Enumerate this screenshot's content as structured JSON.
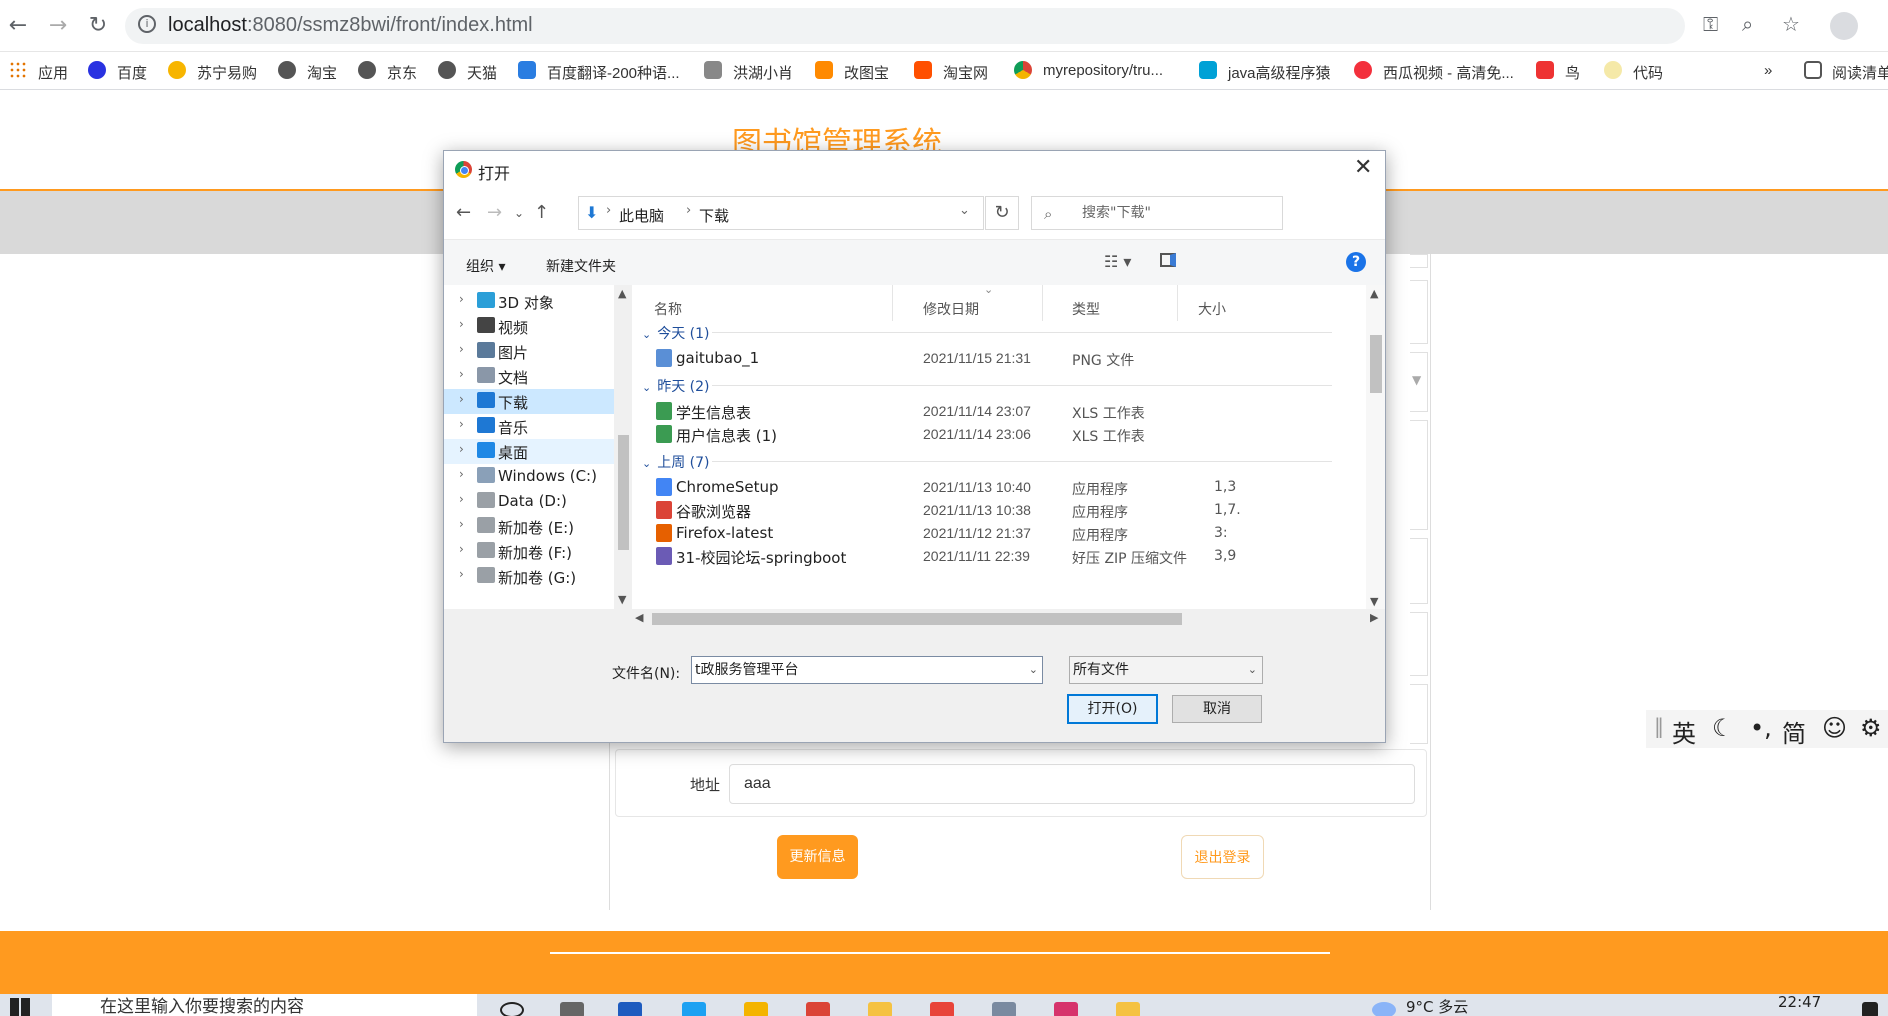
{
  "browser": {
    "url_host": "localhost",
    "url_path": ":8080/ssmz8bwi/front/index.html",
    "bookmarks": [
      "应用",
      "百度",
      "苏宁易购",
      "淘宝",
      "京东",
      "天猫",
      "百度翻译-200种语...",
      "洪湖小肖",
      "改图宝",
      "淘宝网",
      "myrepository/tru...",
      "java高级程序猿",
      "西瓜视频 - 高清免...",
      "鸟",
      "代码"
    ],
    "overflow": "»",
    "reading_list": "阅读清单"
  },
  "page": {
    "site_title": "图书馆管理系统",
    "address_label": "地址",
    "address_value": "aaa",
    "update_button": "更新信息",
    "logout_button": "退出登录"
  },
  "dialog": {
    "title": "打开",
    "breadcrumb": [
      "此电脑",
      "下载"
    ],
    "search_placeholder": "搜索\"下载\"",
    "organize": "组织 ▾",
    "new_folder": "新建文件夹",
    "help": "?",
    "tree": [
      {
        "label": "3D 对象",
        "color": "#2b9fd8"
      },
      {
        "label": "视频",
        "color": "#444"
      },
      {
        "label": "图片",
        "color": "#5b7a9a"
      },
      {
        "label": "文档",
        "color": "#8a97a8"
      },
      {
        "label": "下载",
        "color": "#1e78d4"
      },
      {
        "label": "音乐",
        "color": "#1e78d4"
      },
      {
        "label": "桌面",
        "color": "#1e88e5"
      },
      {
        "label": "Windows (C:)",
        "color": "#8aa0b8"
      },
      {
        "label": "Data (D:)",
        "color": "#9aa0a6"
      },
      {
        "label": "新加卷 (E:)",
        "color": "#9aa0a6"
      },
      {
        "label": "新加卷 (F:)",
        "color": "#9aa0a6"
      },
      {
        "label": "新加卷 (G:)",
        "color": "#9aa0a6"
      }
    ],
    "columns": {
      "name": "名称",
      "date": "修改日期",
      "type": "类型",
      "size": "大小"
    },
    "groups": [
      {
        "label": "今天 (1)",
        "files": [
          {
            "name": "gaitubao_1",
            "date": "2021/11/15 21:31",
            "type": "PNG 文件",
            "size": "",
            "icon": "#5a8fd6"
          }
        ]
      },
      {
        "label": "昨天 (2)",
        "files": [
          {
            "name": "学生信息表",
            "date": "2021/11/14 23:07",
            "type": "XLS 工作表",
            "size": "",
            "icon": "#3b9b52"
          },
          {
            "name": "用户信息表 (1)",
            "date": "2021/11/14 23:06",
            "type": "XLS 工作表",
            "size": "",
            "icon": "#3b9b52"
          }
        ]
      },
      {
        "label": "上周 (7)",
        "files": [
          {
            "name": "ChromeSetup",
            "date": "2021/11/13 10:40",
            "type": "应用程序",
            "size": "1,3",
            "icon": "#4285f4"
          },
          {
            "name": "谷歌浏览器",
            "date": "2021/11/13 10:38",
            "type": "应用程序",
            "size": "1,7.",
            "icon": "#db4437"
          },
          {
            "name": "Firefox-latest",
            "date": "2021/11/12 21:37",
            "type": "应用程序",
            "size": "3:",
            "icon": "#e66000"
          },
          {
            "name": "31-校园论坛-springboot",
            "date": "2021/11/11 22:39",
            "type": "好压 ZIP 压缩文件",
            "size": "3,9",
            "icon": "#6b5bb5"
          }
        ]
      }
    ],
    "filename_label": "文件名(N):",
    "filename_value": "t政服务管理平台",
    "filetype_value": "所有文件",
    "open_button": "打开(O)",
    "cancel_button": "取消"
  },
  "ime": {
    "lang": "英",
    "simplified": "简"
  },
  "taskbar": {
    "search_placeholder": "在这里输入你要搜索的内容",
    "weather": "9°C 多云",
    "time": "22:47"
  }
}
